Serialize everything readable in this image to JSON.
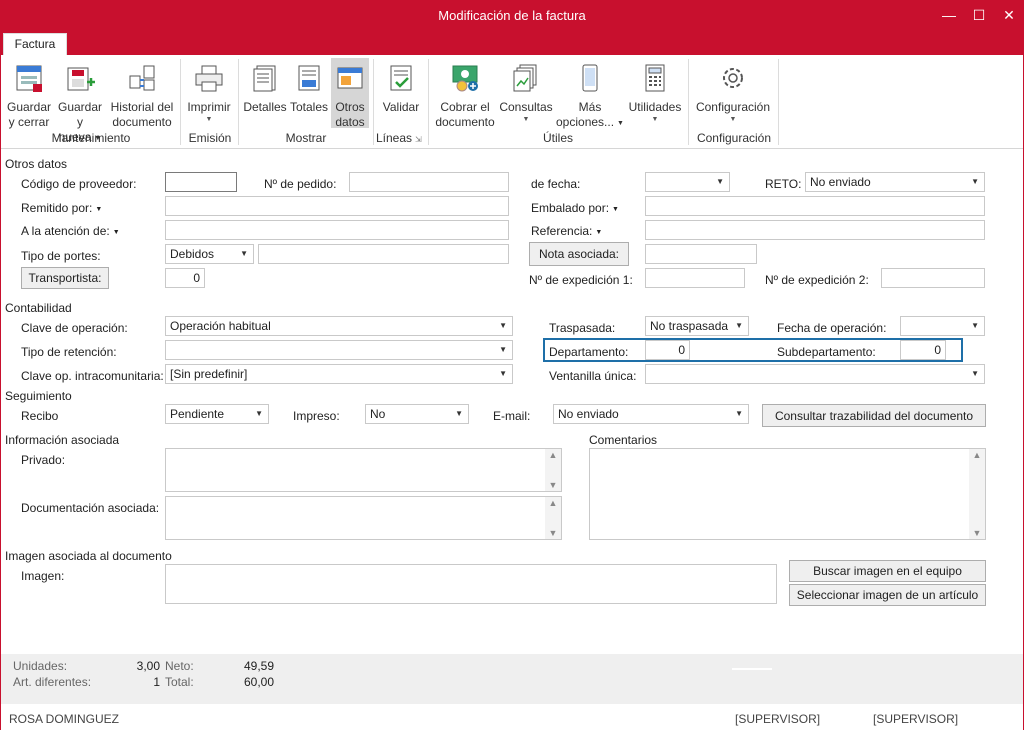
{
  "window": {
    "title": "Modificación de la factura",
    "minimize": "—",
    "maximize": "☐",
    "close": "✕"
  },
  "ribbon": {
    "tab": "Factura",
    "groups": {
      "mantenimiento": "Mantenimiento",
      "emision": "Emisión",
      "mostrar": "Mostrar",
      "lineas": "Líneas",
      "utiles": "Útiles",
      "configuracion": "Configuración"
    },
    "buttons": {
      "guardar_cerrar": [
        "Guardar",
        "y cerrar"
      ],
      "guardar_nueva": [
        "Guardar",
        "y nueva"
      ],
      "historial": [
        "Historial del",
        "documento"
      ],
      "imprimir": "Imprimir",
      "detalles": "Detalles",
      "totales": "Totales",
      "otros_datos": [
        "Otros",
        "datos"
      ],
      "validar": "Validar",
      "cobrar": [
        "Cobrar el",
        "documento"
      ],
      "consultas": "Consultas",
      "mas_opciones": [
        "Más",
        "opciones..."
      ],
      "utilidades": "Utilidades",
      "configuracion": "Configuración"
    },
    "accent": "#c8102e"
  },
  "otros_datos": {
    "section": "Otros datos",
    "codigo_proveedor_label": "Código de proveedor:",
    "codigo_proveedor_value": "",
    "pedido_label": "Nº de pedido:",
    "pedido_value": "",
    "fecha_label": "de fecha:",
    "fecha_value": "",
    "reto_label": "RETO:",
    "reto_value": "No enviado",
    "remitido_label": "Remitido por:",
    "remitido_value": "",
    "embalado_label": "Embalado por:",
    "embalado_value": "",
    "atencion_label": "A la atención de:",
    "atencion_value": "",
    "referencia_label": "Referencia:",
    "referencia_value": "",
    "portes_label": "Tipo de portes:",
    "portes_value": "Debidos",
    "portes_extra": "",
    "nota_asociada_button": "Nota asociada:",
    "nota_asociada_value": "",
    "transportista_button": "Transportista:",
    "transportista_value": "0",
    "expedicion1_label": "Nº de expedición 1:",
    "expedicion1_value": "",
    "expedicion2_label": "Nº de expedición 2:",
    "expedicion2_value": ""
  },
  "contabilidad": {
    "section": "Contabilidad",
    "clave_operacion_label": "Clave de operación:",
    "clave_operacion_value": "Operación habitual",
    "traspasada_label": "Traspasada:",
    "traspasada_value": "No traspasada",
    "fecha_operacion_label": "Fecha de operación:",
    "fecha_operacion_value": "",
    "retencion_label": "Tipo de retención:",
    "retencion_value": "",
    "departamento_label": "Departamento:",
    "departamento_value": "0",
    "subdepartamento_label": "Subdepartamento:",
    "subdepartamento_value": "0",
    "intracomunitaria_label": "Clave op. intracomunitaria:",
    "intracomunitaria_value": "[Sin predefinir]",
    "ventanilla_label": "Ventanilla única:",
    "ventanilla_value": ""
  },
  "seguimiento": {
    "section": "Seguimiento",
    "recibo_label": "Recibo",
    "recibo_value": "Pendiente",
    "impreso_label": "Impreso:",
    "impreso_value": "No",
    "email_label": "E-mail:",
    "email_value": "No enviado",
    "trazabilidad_button": "Consultar trazabilidad del documento"
  },
  "informacion": {
    "section": "Información asociada",
    "privado_label": "Privado:",
    "documentacion_label": "Documentación asociada:",
    "comentarios_label": "Comentarios"
  },
  "imagen": {
    "section": "Imagen asociada al documento",
    "imagen_label": "Imagen:",
    "buscar_button": "Buscar imagen en el equipo",
    "seleccionar_button": "Seleccionar imagen de un artículo"
  },
  "footer": {
    "unidades_label": "Unidades:",
    "unidades_value": "3,00",
    "art_label": "Art. diferentes:",
    "art_value": "1",
    "neto_label": "Neto:",
    "neto_value": "49,59",
    "total_label": "Total:",
    "total_value": "60,00"
  },
  "status": {
    "user": "ROSA DOMINGUEZ",
    "role1": "[SUPERVISOR]",
    "role2": "[SUPERVISOR]"
  },
  "icons": [
    "save-close-icon",
    "save-new-icon",
    "history-icon",
    "printer-icon",
    "details-icon",
    "totals-icon",
    "other-data-icon",
    "validate-icon",
    "collect-icon",
    "queries-icon",
    "phone-icon",
    "calculator-icon",
    "gear-icon"
  ]
}
